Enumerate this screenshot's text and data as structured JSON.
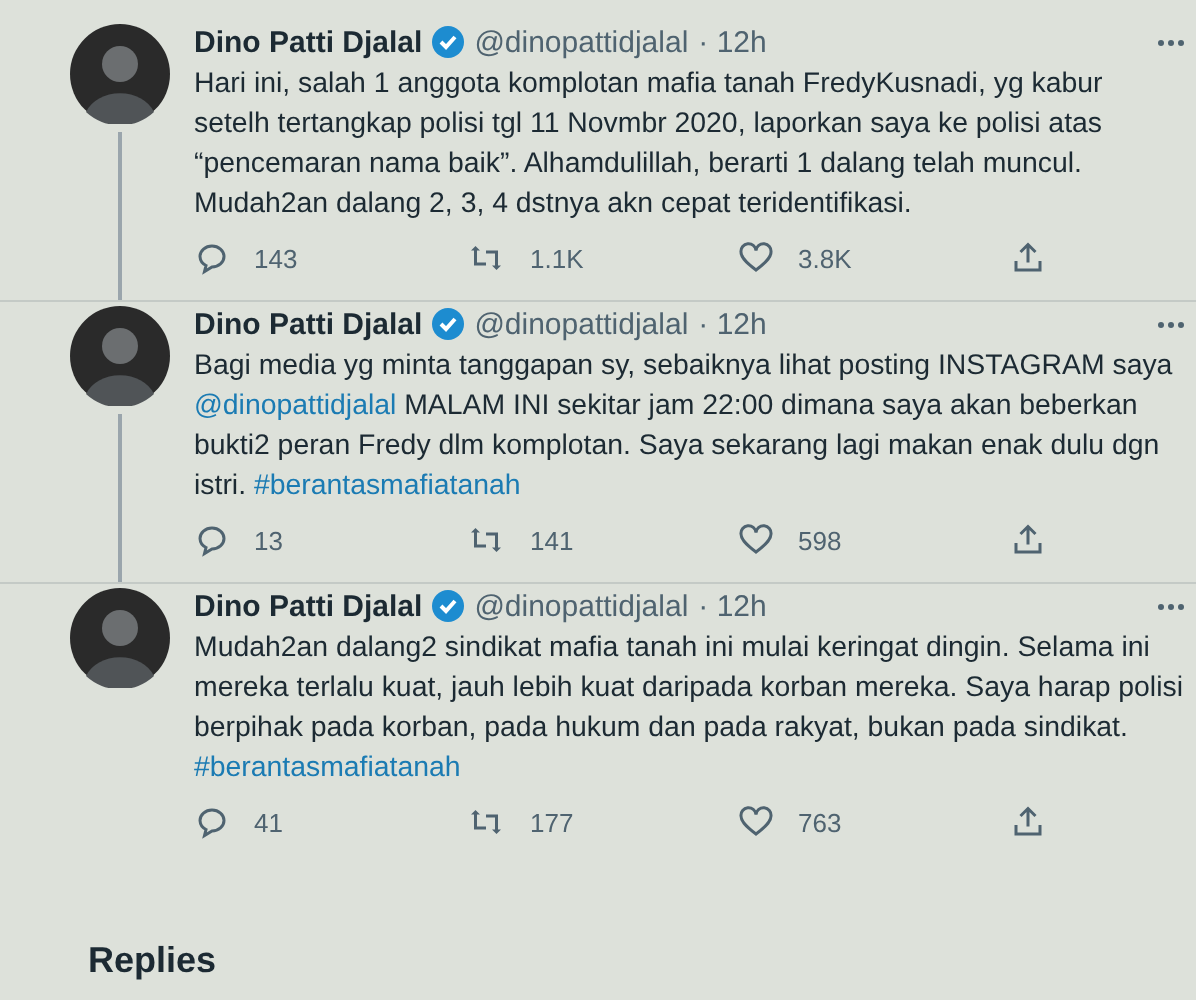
{
  "tweets": [
    {
      "author": "Dino Patti Djalal",
      "verified": true,
      "handle": "@dinopattidjalal",
      "time": "· 12h",
      "thread_line": true,
      "body": [
        {
          "kind": "text",
          "text": "Hari ini, salah 1 anggota komplotan mafia tanah FredyKusnadi, yg kabur setelh tertangkap polisi tgl 11 Novmbr 2020, laporkan saya ke polisi atas “pencemaran nama baik”. Alhamdulillah, berarti 1 dalang telah muncul. Mudah2an dalang 2, 3, 4 dstnya akn cepat teridentifikasi."
        }
      ],
      "replies": "143",
      "retweets": "1.1K",
      "likes": "3.8K"
    },
    {
      "author": "Dino Patti Djalal",
      "verified": true,
      "handle": "@dinopattidjalal",
      "time": "· 12h",
      "thread_line": true,
      "body": [
        {
          "kind": "text",
          "text": "Bagi media yg minta tanggapan sy, sebaiknya lihat posting INSTAGRAM saya "
        },
        {
          "kind": "link",
          "text": "@dinopattidjalal"
        },
        {
          "kind": "text",
          "text": " MALAM INI sekitar jam 22:00 dimana saya akan beberkan bukti2 peran Fredy dlm komplotan. Saya sekarang lagi makan enak dulu dgn istri. "
        },
        {
          "kind": "link",
          "text": "#berantasmafiatanah"
        }
      ],
      "replies": "13",
      "retweets": "141",
      "likes": "598"
    },
    {
      "author": "Dino Patti Djalal",
      "verified": true,
      "handle": "@dinopattidjalal",
      "time": "· 12h",
      "thread_line": false,
      "body": [
        {
          "kind": "text",
          "text": "Mudah2an dalang2 sindikat mafia tanah ini mulai keringat dingin. Selama ini mereka terlalu kuat, jauh lebih kuat daripada korban mereka. Saya harap polisi berpihak pada korban, pada hukum dan pada rakyat, bukan pada sindikat. "
        },
        {
          "kind": "link",
          "text": "#berantasmafiatanah"
        }
      ],
      "replies": "41",
      "retweets": "177",
      "likes": "763"
    }
  ],
  "replies_heading": "Replies"
}
